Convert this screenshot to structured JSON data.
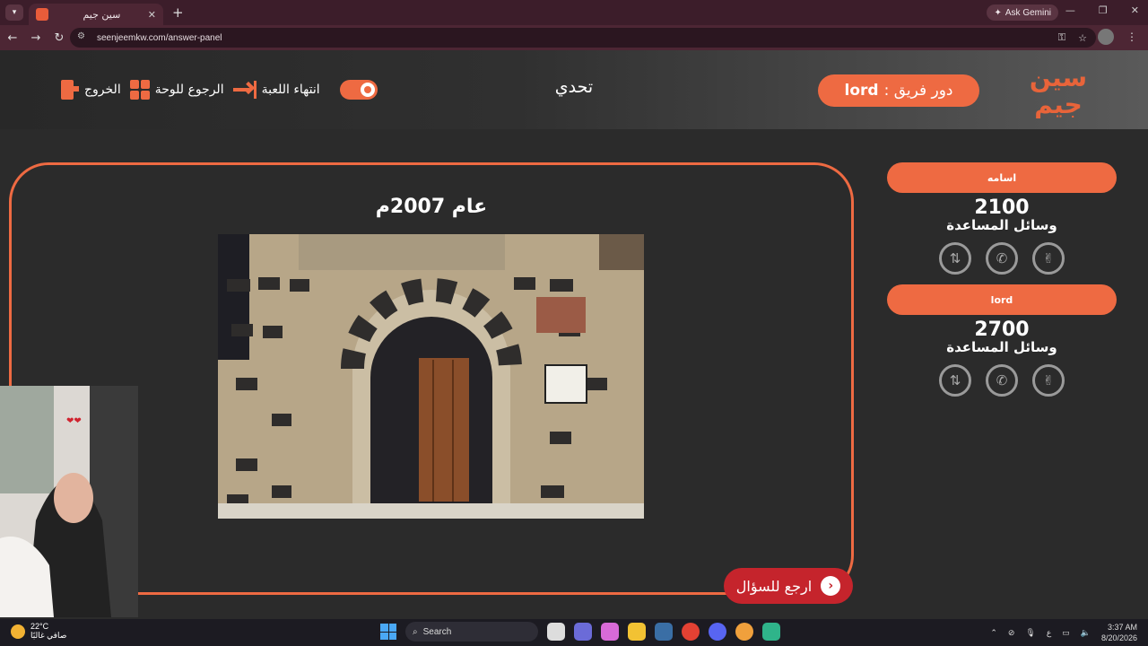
{
  "browser": {
    "tab_title": "سين جيم",
    "url": "seenjeemkw.com/answer-panel",
    "ask_gemini": "Ask Gemini"
  },
  "header": {
    "logo": "سين جيم",
    "turn_label": "دور فريق :",
    "turn_team": "lord",
    "title": "تحدي",
    "end_game": "انتهاء اللعبة",
    "back_board": "الرجوع للوحة",
    "exit": "الخروج"
  },
  "answer": {
    "text": "عام 2007م",
    "image_alt": "مبنى حجري بباب خشبي"
  },
  "back_to_question": "ارجع للسؤال",
  "teams": [
    {
      "name": "اسامه",
      "score": "2100",
      "aids_label": "وسائل المساعدة"
    },
    {
      "name": "lord",
      "score": "2700",
      "aids_label": "وسائل المساعدة"
    }
  ],
  "aid_icons": [
    "two-hands-icon",
    "phone-icon",
    "peace-hand-icon"
  ],
  "taskbar": {
    "temperature": "22°C",
    "weather_text": "صافي غالبًا",
    "search_placeholder": "Search",
    "lang": "ع",
    "time": "3:37 AM",
    "date": "8/20/2026"
  },
  "colors": {
    "accent": "#ee6a42",
    "back_button": "#c5242c",
    "background": "#2b2b2b"
  }
}
